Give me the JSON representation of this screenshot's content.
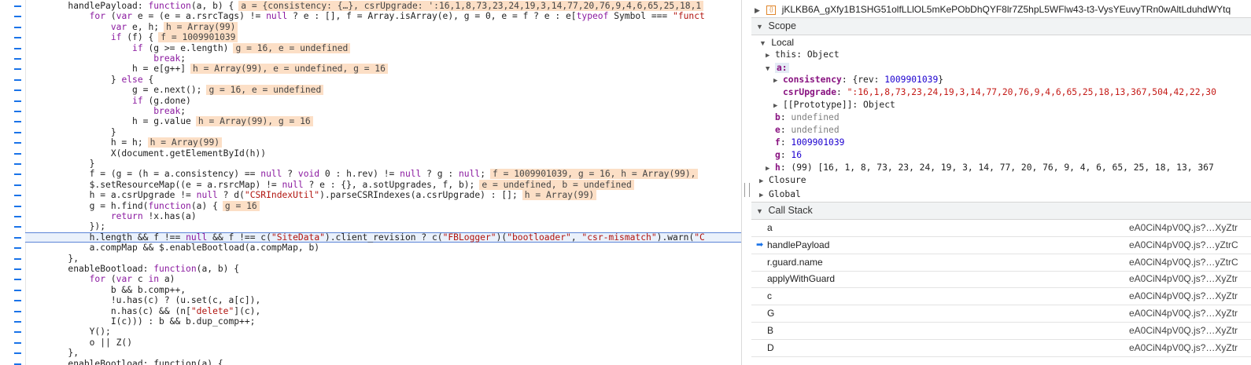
{
  "code": {
    "lines": [
      {
        "id": "l1",
        "indent": "        ",
        "segments": [
          {
            "t": "handlePayload: "
          },
          {
            "t": "function",
            "c": "kw"
          },
          {
            "t": "(a, b) {"
          },
          {
            "t": "a = {consistency: {…}, csrUpgrade: ':16,1,8,73,23,24,19,3,14,77,20,76,9,4,6,65,25,18,1",
            "c": "val"
          }
        ]
      },
      {
        "id": "l2",
        "indent": "            ",
        "segments": [
          {
            "t": "for",
            "c": "kw"
          },
          {
            "t": " ("
          },
          {
            "t": "var",
            "c": "kw"
          },
          {
            "t": " e = (e = a.rsrcTags) != "
          },
          {
            "t": "null",
            "c": "kw"
          },
          {
            "t": " ? e : [], f = Array.isArray(e), g = 0, e = f ? e : e["
          },
          {
            "t": "typeof",
            "c": "kw"
          },
          {
            "t": " Symbol === "
          },
          {
            "t": "\"funct",
            "c": "str"
          }
        ]
      },
      {
        "id": "l3",
        "indent": "                ",
        "segments": [
          {
            "t": "var",
            "c": "kw"
          },
          {
            "t": " e, h;"
          },
          {
            "t": "h = Array(99)",
            "c": "val"
          }
        ]
      },
      {
        "id": "l4",
        "indent": "                ",
        "segments": [
          {
            "t": "if",
            "c": "kw"
          },
          {
            "t": " (f) {"
          },
          {
            "t": "f = 1009901039",
            "c": "val"
          }
        ]
      },
      {
        "id": "l5",
        "indent": "                    ",
        "segments": [
          {
            "t": "if",
            "c": "kw"
          },
          {
            "t": " (g >= e.length)"
          },
          {
            "t": "g = 16, e = undefined",
            "c": "val"
          }
        ]
      },
      {
        "id": "l6",
        "indent": "                        ",
        "segments": [
          {
            "t": "break",
            "c": "kw"
          },
          {
            "t": ";"
          }
        ]
      },
      {
        "id": "l7",
        "indent": "                    ",
        "segments": [
          {
            "t": "h = e[g++]"
          },
          {
            "t": "h = Array(99), e = undefined, g = 16",
            "c": "val"
          }
        ]
      },
      {
        "id": "l8",
        "indent": "                ",
        "segments": [
          {
            "t": "} "
          },
          {
            "t": "else",
            "c": "kw"
          },
          {
            "t": " {"
          }
        ]
      },
      {
        "id": "l9",
        "indent": "                    ",
        "segments": [
          {
            "t": "g = e.next();"
          },
          {
            "t": "g = 16, e = undefined",
            "c": "val"
          }
        ]
      },
      {
        "id": "l10",
        "indent": "                    ",
        "segments": [
          {
            "t": "if",
            "c": "kw"
          },
          {
            "t": " (g.done)"
          }
        ]
      },
      {
        "id": "l11",
        "indent": "                        ",
        "segments": [
          {
            "t": "break",
            "c": "kw"
          },
          {
            "t": ";"
          }
        ]
      },
      {
        "id": "l12",
        "indent": "                    ",
        "segments": [
          {
            "t": "h = g.value"
          },
          {
            "t": "h = Array(99), g = 16",
            "c": "val"
          }
        ]
      },
      {
        "id": "l13",
        "indent": "                ",
        "segments": [
          {
            "t": "}"
          }
        ]
      },
      {
        "id": "l14",
        "indent": "                ",
        "segments": [
          {
            "t": "h = h;"
          },
          {
            "t": "h = Array(99)",
            "c": "val"
          }
        ]
      },
      {
        "id": "l15",
        "indent": "                ",
        "segments": [
          {
            "t": "X(document.getElementById(h))"
          }
        ]
      },
      {
        "id": "l16",
        "indent": "            ",
        "segments": [
          {
            "t": "}"
          }
        ]
      },
      {
        "id": "l17",
        "indent": "            ",
        "segments": [
          {
            "t": "f = (g = (h = a.consistency) == "
          },
          {
            "t": "null",
            "c": "kw"
          },
          {
            "t": " ? "
          },
          {
            "t": "void",
            "c": "kw"
          },
          {
            "t": " 0 : h.rev) != "
          },
          {
            "t": "null",
            "c": "kw"
          },
          {
            "t": " ? g : "
          },
          {
            "t": "null",
            "c": "kw"
          },
          {
            "t": ";"
          },
          {
            "t": "f = 1009901039, g = 16, h = Array(99),",
            "c": "val"
          }
        ]
      },
      {
        "id": "l18",
        "indent": "            ",
        "segments": [
          {
            "t": "$.setResourceMap((e = a.rsrcMap) != "
          },
          {
            "t": "null",
            "c": "kw"
          },
          {
            "t": " ? e : {}, a.sotUpgrades, f, b);"
          },
          {
            "t": "e = undefined, b = undefined",
            "c": "val"
          }
        ]
      },
      {
        "id": "l19",
        "indent": "            ",
        "segments": [
          {
            "t": "h = a.csrUpgrade != "
          },
          {
            "t": "null",
            "c": "kw"
          },
          {
            "t": " ? d("
          },
          {
            "t": "\"CSRIndexUtil\"",
            "c": "str"
          },
          {
            "t": ").parseCSRIndexes(a.csrUpgrade) : [];"
          },
          {
            "t": "h = Array(99)",
            "c": "val"
          }
        ]
      },
      {
        "id": "l20",
        "indent": "            ",
        "segments": [
          {
            "t": "g = h.find("
          },
          {
            "t": "function",
            "c": "kw"
          },
          {
            "t": "(a) {"
          },
          {
            "t": "g = 16",
            "c": "val"
          }
        ]
      },
      {
        "id": "l21",
        "indent": "                ",
        "segments": [
          {
            "t": "return",
            "c": "kw"
          },
          {
            "t": " !x.has(a)"
          }
        ]
      },
      {
        "id": "l22",
        "indent": "            ",
        "segments": [
          {
            "t": "});"
          }
        ]
      },
      {
        "id": "l23",
        "indent": "            ",
        "current": true,
        "segments": [
          {
            "t": "h.length && f !== "
          },
          {
            "t": "null",
            "c": "kw"
          },
          {
            "t": " && f !== c("
          },
          {
            "t": "\"SiteData\"",
            "c": "str"
          },
          {
            "t": ").client_revision ? c("
          },
          {
            "t": "\"FBLogger\"",
            "c": "str"
          },
          {
            "t": ")("
          },
          {
            "t": "\"bootloader\"",
            "c": "str"
          },
          {
            "t": ", "
          },
          {
            "t": "\"csr-mismatch\"",
            "c": "str"
          },
          {
            "t": ").warn("
          },
          {
            "t": "\"C",
            "c": "str"
          }
        ]
      },
      {
        "id": "l24",
        "indent": "            ",
        "segments": [
          {
            "t": "a.compMap && $.enableBootload(a.compMap, b)"
          }
        ]
      },
      {
        "id": "l25",
        "indent": "        ",
        "segments": [
          {
            "t": "},"
          }
        ]
      },
      {
        "id": "l26",
        "indent": "        ",
        "segments": [
          {
            "t": "enableBootload: "
          },
          {
            "t": "function",
            "c": "kw"
          },
          {
            "t": "(a, b) {"
          }
        ]
      },
      {
        "id": "l27",
        "indent": "            ",
        "segments": [
          {
            "t": "for",
            "c": "kw"
          },
          {
            "t": " ("
          },
          {
            "t": "var",
            "c": "kw"
          },
          {
            "t": " c "
          },
          {
            "t": "in",
            "c": "kw"
          },
          {
            "t": " a)"
          }
        ]
      },
      {
        "id": "l28",
        "indent": "                ",
        "segments": [
          {
            "t": "b && b.comp++,"
          }
        ]
      },
      {
        "id": "l29",
        "indent": "                ",
        "segments": [
          {
            "t": "!u.has(c) ? (u.set(c, a[c]),"
          }
        ]
      },
      {
        "id": "l30",
        "indent": "                ",
        "segments": [
          {
            "t": "n.has(c) && (n["
          },
          {
            "t": "\"delete\"",
            "c": "str"
          },
          {
            "t": "](c),"
          }
        ]
      },
      {
        "id": "l31",
        "indent": "                ",
        "segments": [
          {
            "t": "I(c))) : b && b.dup_comp++;"
          }
        ]
      },
      {
        "id": "l32",
        "indent": "            ",
        "segments": [
          {
            "t": "Y();"
          }
        ]
      },
      {
        "id": "l33",
        "indent": "            ",
        "segments": [
          {
            "t": "o || Z()"
          }
        ]
      },
      {
        "id": "l34",
        "indent": "        ",
        "segments": [
          {
            "t": "},"
          }
        ]
      },
      {
        "id": "l35",
        "indent": "        ",
        "segments": [
          {
            "t": "enableBootload: function(a) {",
            "c": "partial"
          }
        ]
      }
    ]
  },
  "debug": {
    "top_file": "jKLKB6A_gXfy1B1SHG51olfLLlOL5mKePObDhQYF8lr7Z5hpL5WFlw43-t3-VysYEuvyTRn0wAltLduhdWYtq",
    "scope_label": "Scope",
    "local_label": "Local",
    "this_label": "this",
    "this_value": "Object",
    "a_label": "a:",
    "consistency_key": "consistency",
    "consistency_prefix": "{rev: ",
    "consistency_rev": "1009901039",
    "consistency_suffix": "}",
    "csrupgrade_key": "csrUpgrade",
    "csrupgrade_value": "\":16,1,8,73,23,24,19,3,14,77,20,76,9,4,6,65,25,18,13,367,504,42,22,30",
    "prototype_label": "[[Prototype]]",
    "prototype_value": "Object",
    "b_key": "b",
    "b_value": "undefined",
    "e_key": "e",
    "e_value": "undefined",
    "f_key": "f",
    "f_value": "1009901039",
    "g_key": "g",
    "g_value": "16",
    "h_key": "h",
    "h_count": "(99)",
    "h_value": "[16, 1, 8, 73, 23, 24, 19, 3, 14, 77, 20, 76, 9, 4, 6, 65, 25, 18, 13, 367",
    "closure_label": "Closure",
    "global_label": "Global",
    "callstack_label": "Call Stack",
    "frames": [
      {
        "name": "a",
        "loc": "eA0CiN4pV0Q.js?…XyZtr"
      },
      {
        "name": "handlePayload",
        "loc": "eA0CiN4pV0Q.js?…yZtrC",
        "active": true
      },
      {
        "name": "r.guard.name",
        "loc": "eA0CiN4pV0Q.js?…yZtrC"
      },
      {
        "name": "applyWithGuard",
        "loc": "eA0CiN4pV0Q.js?…XyZtr"
      },
      {
        "name": "c",
        "loc": "eA0CiN4pV0Q.js?…XyZtr"
      },
      {
        "name": "G",
        "loc": "eA0CiN4pV0Q.js?…XyZtr"
      },
      {
        "name": "B",
        "loc": "eA0CiN4pV0Q.js?…XyZtr"
      },
      {
        "name": "D",
        "loc": "eA0CiN4pV0Q.js?…XyZtr"
      }
    ]
  }
}
